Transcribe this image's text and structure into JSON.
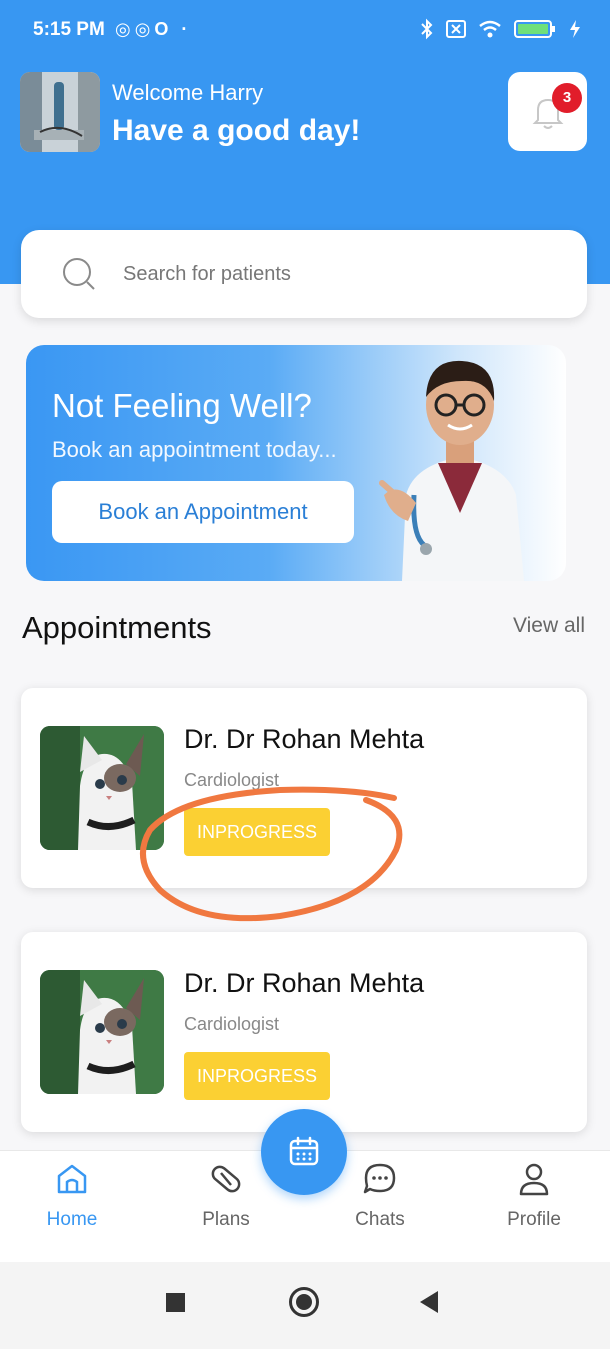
{
  "status_bar": {
    "time": "5:15 PM",
    "left_icons": "◎◎O ·"
  },
  "header": {
    "welcome": "Welcome Harry",
    "greeting": "Have a good day!",
    "notification_count": "3"
  },
  "search": {
    "placeholder": "Search for patients"
  },
  "banner": {
    "title": "Not Feeling Well?",
    "subtitle": "Book an appointment today...",
    "button_label": "Book an Appointment"
  },
  "appointments": {
    "title": "Appointments",
    "view_all": "View all",
    "items": [
      {
        "doctor": "Dr. Dr Rohan Mehta",
        "specialty": "Cardiologist",
        "status": "INPROGRESS"
      },
      {
        "doctor": "Dr. Dr Rohan Mehta",
        "specialty": "Cardiologist",
        "status": "INPROGRESS"
      }
    ]
  },
  "bottom_nav": {
    "items": [
      {
        "label": "Home",
        "icon": "home-icon"
      },
      {
        "label": "Plans",
        "icon": "pill-icon"
      },
      {
        "label": "Chats",
        "icon": "chat-icon"
      },
      {
        "label": "Profile",
        "icon": "user-icon"
      }
    ],
    "fab_icon": "calendar-icon"
  },
  "colors": {
    "primary": "#3897f2",
    "badge": "#e11d2a",
    "status_inprogress": "#fbd033",
    "annotation": "#f07840"
  }
}
